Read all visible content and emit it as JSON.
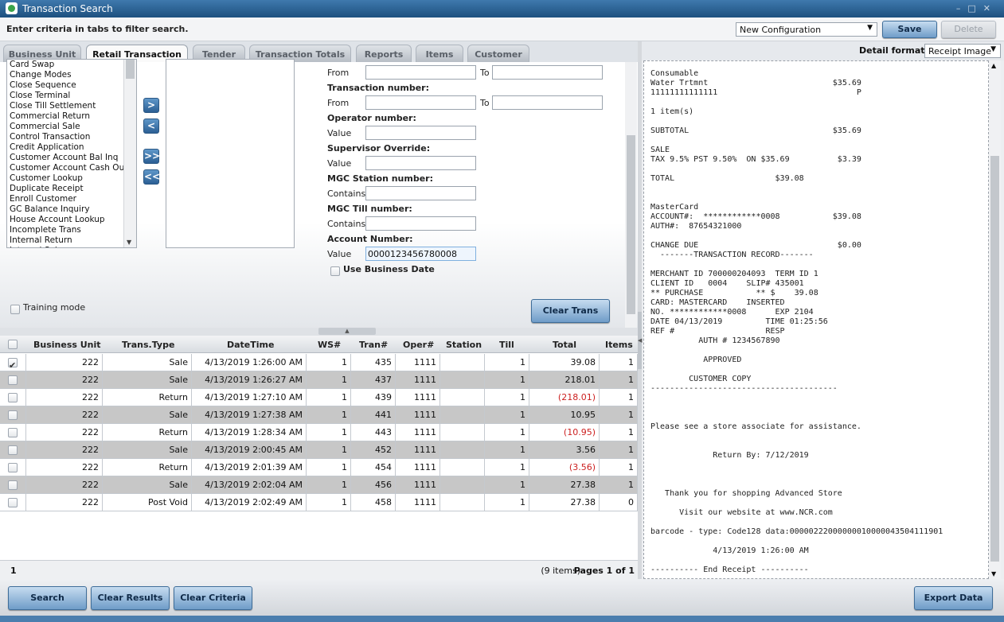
{
  "window": {
    "title": "Transaction Search",
    "icon": "app-logo-icon"
  },
  "criteria_bar": {
    "instruction": "Enter criteria in tabs to filter search.",
    "configuration": "New Configuration",
    "save_label": "Save",
    "delete_label": "Delete"
  },
  "tabs": [
    {
      "label": "Business Unit",
      "active": false
    },
    {
      "label": "Retail Transaction",
      "active": true
    },
    {
      "label": "Tender",
      "active": false
    },
    {
      "label": "Transaction Totals",
      "active": false
    },
    {
      "label": "Reports",
      "active": false
    },
    {
      "label": "Items",
      "active": false
    },
    {
      "label": "Customer",
      "active": false
    }
  ],
  "type_list": [
    "Card Swap",
    "Change Modes",
    "Close Sequence",
    "Close Terminal",
    "Close Till Settlement",
    "Commercial Return",
    "Commercial Sale",
    "Control Transaction",
    "Credit Application",
    "Customer Account Bal Inq",
    "Customer Account Cash Out",
    "Customer Lookup",
    "Duplicate Receipt",
    "Enroll Customer",
    "GC Balance Inquiry",
    "House Account Lookup",
    "Incomplete Trans",
    "Internal Return",
    "Internal Sale"
  ],
  "move_buttons": [
    ">",
    "<",
    ">>",
    "<<"
  ],
  "fields": {
    "date_from_label": "From",
    "date_to_label": "To",
    "txn_number_header": "Transaction number:",
    "txn_from_label": "From",
    "txn_to_label": "To",
    "operator_header": "Operator number:",
    "operator_value_label": "Value",
    "supervisor_header": "Supervisor Override:",
    "supervisor_value_label": "Value",
    "mgc_station_header": "MGC Station number:",
    "mgc_station_label": "Contains",
    "mgc_till_header": "MGC Till number:",
    "mgc_till_label": "Contains",
    "account_header": "Account Number:",
    "account_value_label": "Value",
    "account_value": "0000123456780008",
    "use_business_date": "Use Business Date"
  },
  "training_mode": "Training mode",
  "clear_trans_label": "Clear Trans",
  "grid": {
    "columns": [
      "Business Unit",
      "Trans.Type",
      "DateTime",
      "WS#",
      "Tran#",
      "Oper#",
      "Station",
      "Till",
      "Total",
      "Items"
    ],
    "rows": [
      {
        "checked": true,
        "bu": "222",
        "type": "Sale",
        "datetime": "4/13/2019 1:26:00 AM",
        "ws": "1",
        "tran": "435",
        "oper": "1111",
        "station": "",
        "till": "1",
        "total": "39.08",
        "items": "1",
        "neg": false
      },
      {
        "checked": false,
        "bu": "222",
        "type": "Sale",
        "datetime": "4/13/2019 1:26:27 AM",
        "ws": "1",
        "tran": "437",
        "oper": "1111",
        "station": "",
        "till": "1",
        "total": "218.01",
        "items": "1",
        "neg": false
      },
      {
        "checked": false,
        "bu": "222",
        "type": "Return",
        "datetime": "4/13/2019 1:27:10 AM",
        "ws": "1",
        "tran": "439",
        "oper": "1111",
        "station": "",
        "till": "1",
        "total": "(218.01)",
        "items": "1",
        "neg": true
      },
      {
        "checked": false,
        "bu": "222",
        "type": "Sale",
        "datetime": "4/13/2019 1:27:38 AM",
        "ws": "1",
        "tran": "441",
        "oper": "1111",
        "station": "",
        "till": "1",
        "total": "10.95",
        "items": "1",
        "neg": false
      },
      {
        "checked": false,
        "bu": "222",
        "type": "Return",
        "datetime": "4/13/2019 1:28:34 AM",
        "ws": "1",
        "tran": "443",
        "oper": "1111",
        "station": "",
        "till": "1",
        "total": "(10.95)",
        "items": "1",
        "neg": true
      },
      {
        "checked": false,
        "bu": "222",
        "type": "Sale",
        "datetime": "4/13/2019 2:00:45 AM",
        "ws": "1",
        "tran": "452",
        "oper": "1111",
        "station": "",
        "till": "1",
        "total": "3.56",
        "items": "1",
        "neg": false
      },
      {
        "checked": false,
        "bu": "222",
        "type": "Return",
        "datetime": "4/13/2019 2:01:39 AM",
        "ws": "1",
        "tran": "454",
        "oper": "1111",
        "station": "",
        "till": "1",
        "total": "(3.56)",
        "items": "1",
        "neg": true
      },
      {
        "checked": false,
        "bu": "222",
        "type": "Sale",
        "datetime": "4/13/2019 2:02:04 AM",
        "ws": "1",
        "tran": "456",
        "oper": "1111",
        "station": "",
        "till": "1",
        "total": "27.38",
        "items": "1",
        "neg": false
      },
      {
        "checked": false,
        "bu": "222",
        "type": "Post Void",
        "datetime": "4/13/2019 2:02:49 AM",
        "ws": "1",
        "tran": "458",
        "oper": "1111",
        "station": "",
        "till": "1",
        "total": "27.38",
        "items": "0",
        "neg": false
      }
    ],
    "footer_page": "1",
    "footer_count": "(9 items)",
    "footer_pages": "Pages 1 of 1"
  },
  "bottom_buttons": {
    "search": "Search",
    "clear_results": "Clear Results",
    "clear_criteria": "Clear Criteria",
    "export": "Export Data"
  },
  "detail": {
    "format_label": "Detail format:",
    "format_value": "Receipt Image",
    "receipt_text": "Consumable\nWater Trtmnt                          $35.69\n11111111111111                             P\n\n1 item(s)\n\nSUBTOTAL                              $35.69\n\nSALE\nTAX 9.5% PST 9.50%  ON $35.69          $3.39\n\nTOTAL                     $39.08\n\n\nMasterCard\nACCOUNT#:  ************0008           $39.08\nAUTH#:  87654321000\n\nCHANGE DUE                             $0.00\n  -------TRANSACTION RECORD-------\n\nMERCHANT ID 700000204093  TERM ID 1\nCLIENT ID   0004    SLIP# 435001\n** PURCHASE           ** $    39.08\nCARD: MASTERCARD    INSERTED\nNO. ************0008      EXP 2104\nDATE 04/13/2019         TIME 01:25:56\nREF #                   RESP\n          AUTH # 1234567890\n\n           APPROVED\n\n        CUSTOMER COPY\n---------------------------------------\n\n\n\nPlease see a store associate for assistance.\n\n\n             Return By: 7/12/2019\n\n\n\n   Thank you for shopping Advanced Store\n\n      Visit our website at www.NCR.com\n\nbarcode - type: Code128 data:00000222000000010000043504111901\n\n             4/13/2019 1:26:00 AM\n\n---------- End Receipt ----------"
  }
}
